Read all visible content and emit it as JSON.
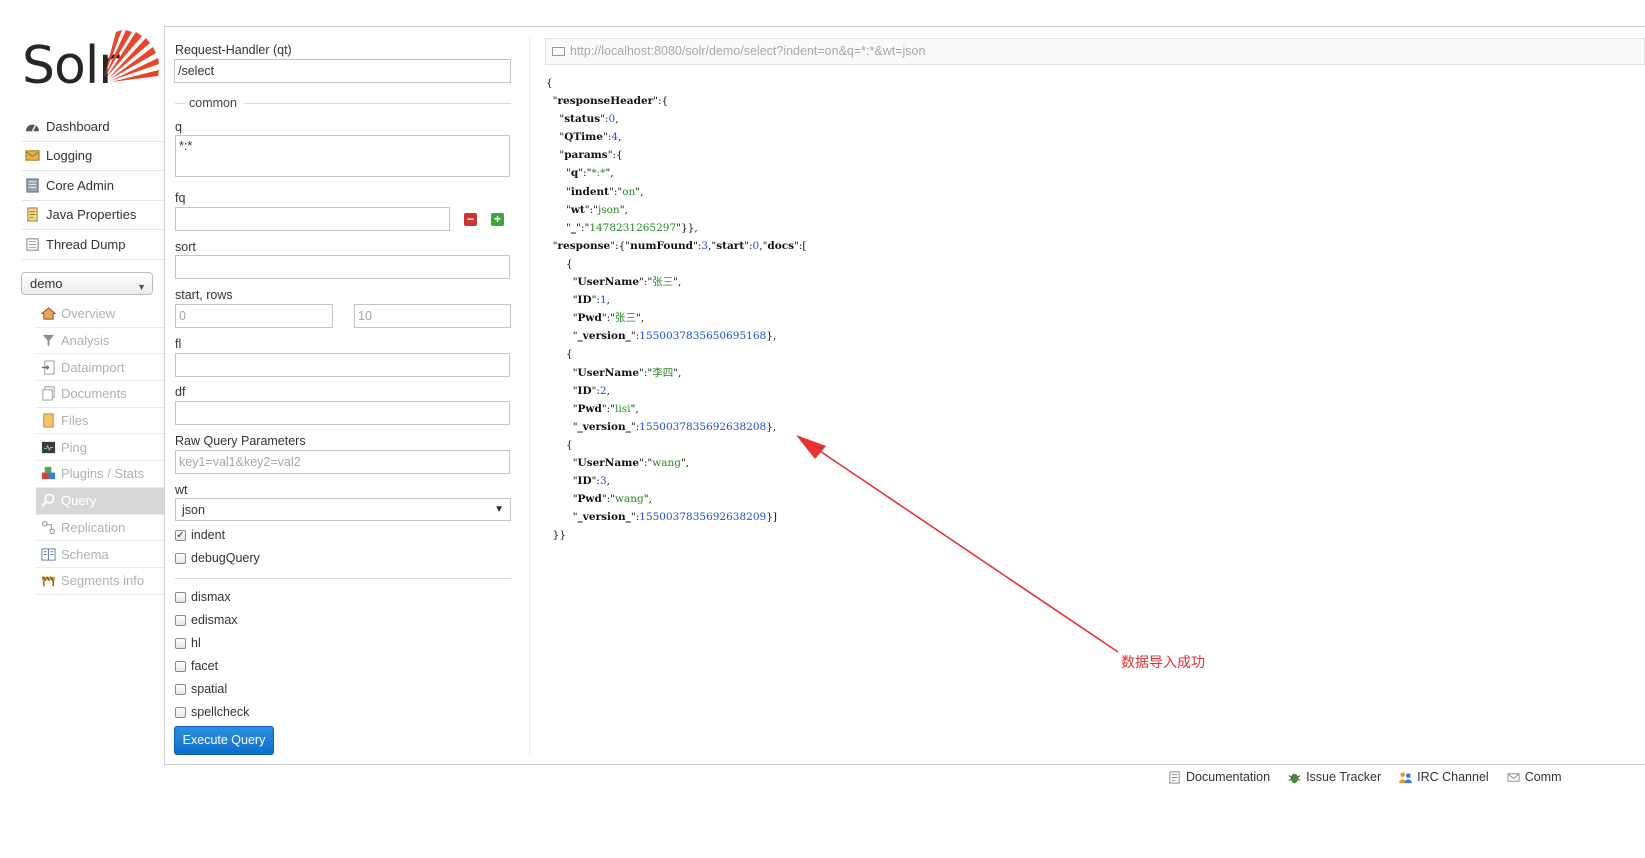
{
  "logo": {
    "text": "Solr"
  },
  "nav": {
    "items": [
      {
        "label": "Dashboard",
        "icon": "dashboard-icon"
      },
      {
        "label": "Logging",
        "icon": "logging-icon"
      },
      {
        "label": "Core Admin",
        "icon": "core-admin-icon"
      },
      {
        "label": "Java Properties",
        "icon": "java-properties-icon"
      },
      {
        "label": "Thread Dump",
        "icon": "thread-dump-icon"
      }
    ],
    "core_selector": {
      "value": "demo"
    },
    "core_items": [
      {
        "label": "Overview",
        "icon": "overview-icon"
      },
      {
        "label": "Analysis",
        "icon": "analysis-icon"
      },
      {
        "label": "Dataimport",
        "icon": "dataimport-icon"
      },
      {
        "label": "Documents",
        "icon": "documents-icon"
      },
      {
        "label": "Files",
        "icon": "files-icon"
      },
      {
        "label": "Ping",
        "icon": "ping-icon"
      },
      {
        "label": "Plugins / Stats",
        "icon": "plugins-icon"
      },
      {
        "label": "Query",
        "icon": "query-icon",
        "active": true
      },
      {
        "label": "Replication",
        "icon": "replication-icon"
      },
      {
        "label": "Schema",
        "icon": "schema-icon"
      },
      {
        "label": "Segments info",
        "icon": "segments-icon"
      }
    ]
  },
  "form": {
    "qt_label": "Request-Handler (qt)",
    "qt_value": "/select",
    "common_legend": "common",
    "q_label": "q",
    "q_value": "*:*",
    "fq_label": "fq",
    "fq_value": "",
    "sort_label": "sort",
    "sort_value": "",
    "start_rows_label": "start, rows",
    "start_placeholder": "0",
    "rows_placeholder": "10",
    "fl_label": "fl",
    "df_label": "df",
    "raw_label": "Raw Query Parameters",
    "raw_placeholder": "key1=val1&key2=val2",
    "wt_label": "wt",
    "wt_value": "json",
    "indent_label": "indent",
    "indent_checked": true,
    "debug_label": "debugQuery",
    "options": [
      "dismax",
      "edismax",
      "hl",
      "facet",
      "spatial",
      "spellcheck"
    ],
    "execute_label": "Execute Query"
  },
  "result": {
    "url": "http://localhost:8080/solr/demo/select?indent=on&q=*:*&wt=json",
    "status": "0",
    "qtime": "4",
    "params": {
      "q": "*:*",
      "indent": "on",
      "wt": "json",
      "underscore": "1478231265297"
    },
    "num_found": "3",
    "start": "0",
    "docs": [
      {
        "UserName": "张三",
        "ID": "1",
        "Pwd": "张三",
        "version": "1550037835650695168"
      },
      {
        "UserName": "李四",
        "ID": "2",
        "Pwd": "lisi",
        "version": "1550037835692638208"
      },
      {
        "UserName": "wang",
        "ID": "3",
        "Pwd": "wang",
        "version": "1550037835692638209"
      }
    ]
  },
  "annotation": {
    "text": "数据导入成功",
    "color": "#e03030"
  },
  "footer": {
    "items": [
      {
        "label": "Documentation",
        "icon": "documentation-icon"
      },
      {
        "label": "Issue Tracker",
        "icon": "issue-tracker-icon"
      },
      {
        "label": "IRC Channel",
        "icon": "irc-channel-icon"
      },
      {
        "label": "Comm",
        "icon": "community-icon"
      }
    ]
  }
}
